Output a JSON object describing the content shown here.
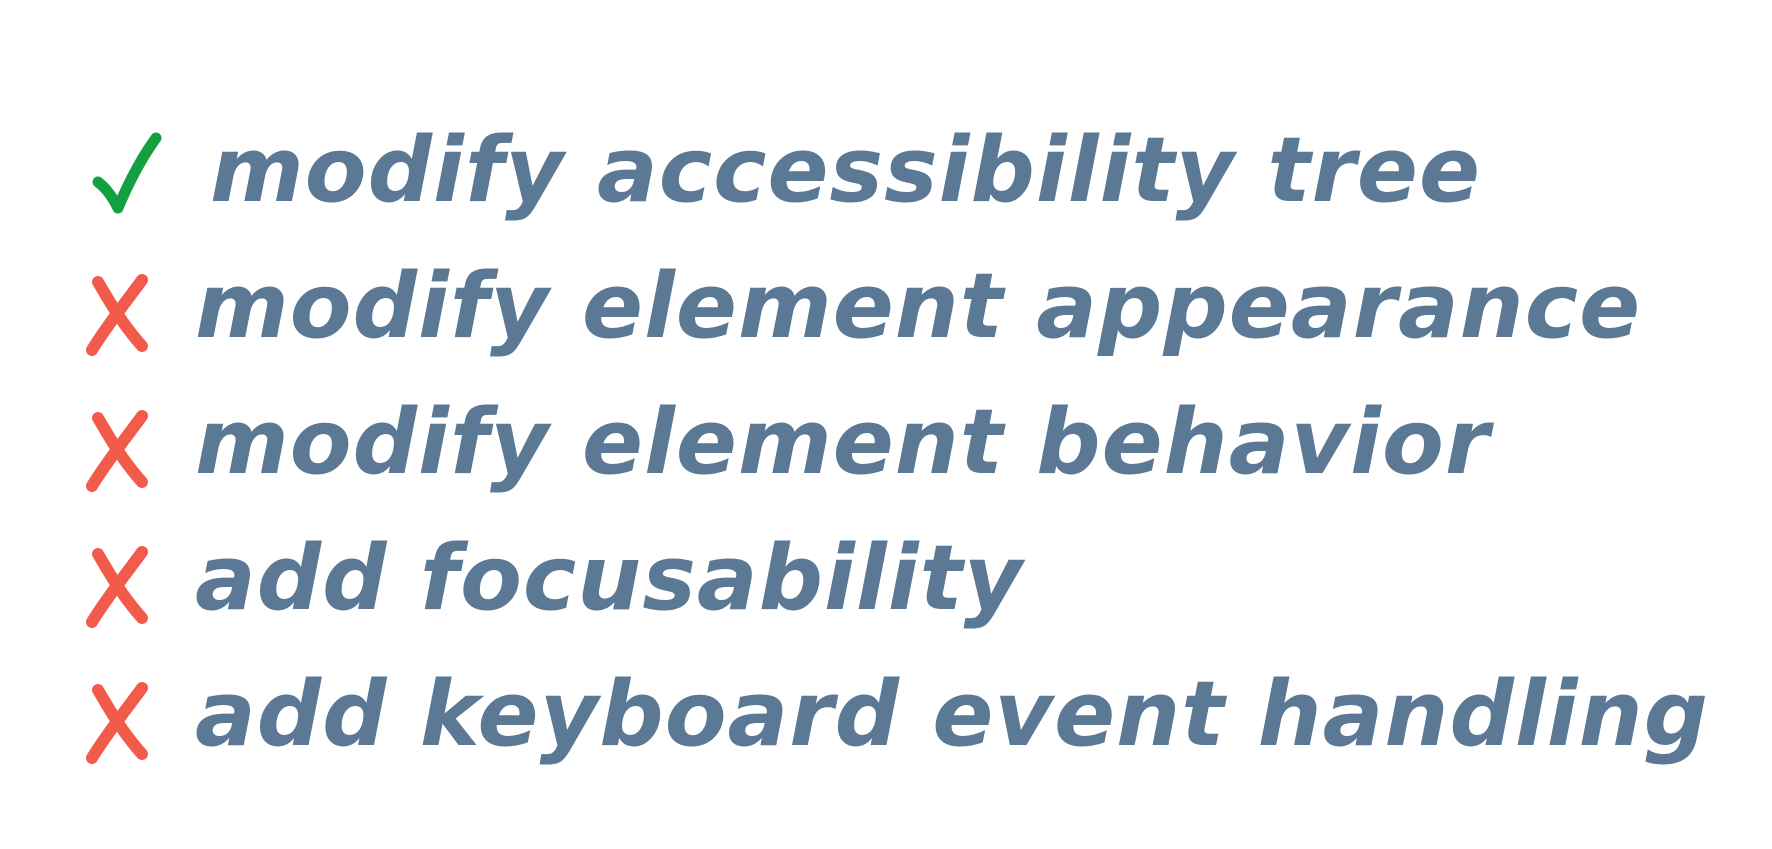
{
  "colors": {
    "text": "#5b7894",
    "check": "#14a040",
    "cross": "#f25a4a",
    "background": "#ffffff"
  },
  "items": [
    {
      "status": "check",
      "icon": "check-icon",
      "label": "modify accessibility tree"
    },
    {
      "status": "cross",
      "icon": "cross-icon",
      "label": "modify element appearance"
    },
    {
      "status": "cross",
      "icon": "cross-icon",
      "label": "modify element behavior"
    },
    {
      "status": "cross",
      "icon": "cross-icon",
      "label": "add focusability"
    },
    {
      "status": "cross",
      "icon": "cross-icon",
      "label": "add keyboard event handling"
    }
  ]
}
